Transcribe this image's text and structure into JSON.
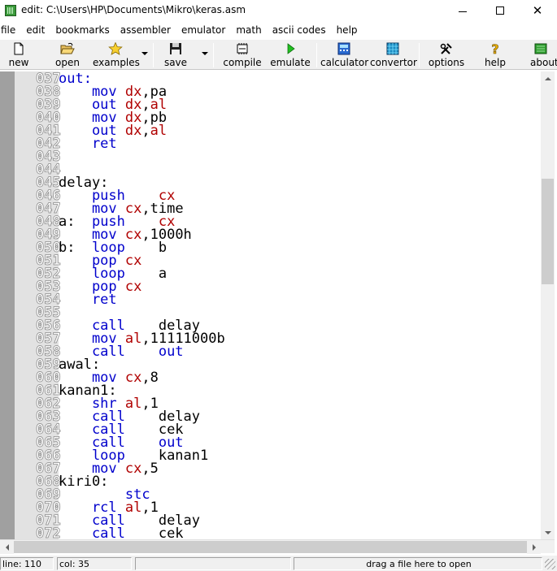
{
  "window": {
    "title": "edit: C:\\Users\\HP\\Documents\\Mikro\\keras.asm",
    "minimize": "minimize",
    "maximize": "maximize",
    "close": "✕"
  },
  "menu": [
    "file",
    "edit",
    "bookmarks",
    "assembler",
    "emulator",
    "math",
    "ascii codes",
    "help"
  ],
  "toolbar": {
    "new": "new",
    "open": "open",
    "examples": "examples",
    "save": "save",
    "compile": "compile",
    "emulate": "emulate",
    "calculator": "calculator",
    "convertor": "convertor",
    "options": "options",
    "help": "help",
    "about": "about"
  },
  "editor": {
    "lines": [
      {
        "num": "037",
        "segs": [
          {
            "t": "out:",
            "c": "kw"
          }
        ]
      },
      {
        "num": "038",
        "segs": [
          {
            "t": "    mov ",
            "c": "kw"
          },
          {
            "t": "dx",
            "c": "reg"
          },
          {
            "t": ",pa",
            "c": "plain"
          }
        ]
      },
      {
        "num": "039",
        "segs": [
          {
            "t": "    out ",
            "c": "kw"
          },
          {
            "t": "dx",
            "c": "reg"
          },
          {
            "t": ",",
            "c": "plain"
          },
          {
            "t": "al",
            "c": "reg"
          }
        ]
      },
      {
        "num": "040",
        "segs": [
          {
            "t": "    mov ",
            "c": "kw"
          },
          {
            "t": "dx",
            "c": "reg"
          },
          {
            "t": ",pb",
            "c": "plain"
          }
        ]
      },
      {
        "num": "041",
        "segs": [
          {
            "t": "    out ",
            "c": "kw"
          },
          {
            "t": "dx",
            "c": "reg"
          },
          {
            "t": ",",
            "c": "plain"
          },
          {
            "t": "al",
            "c": "reg"
          }
        ]
      },
      {
        "num": "042",
        "segs": [
          {
            "t": "    ret",
            "c": "kw"
          }
        ]
      },
      {
        "num": "043",
        "segs": []
      },
      {
        "num": "044",
        "segs": []
      },
      {
        "num": "045",
        "segs": [
          {
            "t": "delay:",
            "c": "plain"
          }
        ]
      },
      {
        "num": "046",
        "segs": [
          {
            "t": "    push    ",
            "c": "kw"
          },
          {
            "t": "cx",
            "c": "reg"
          }
        ]
      },
      {
        "num": "047",
        "segs": [
          {
            "t": "    mov ",
            "c": "kw"
          },
          {
            "t": "cx",
            "c": "reg"
          },
          {
            "t": ",time",
            "c": "plain"
          }
        ]
      },
      {
        "num": "048",
        "segs": [
          {
            "t": "a:  ",
            "c": "plain"
          },
          {
            "t": "push    ",
            "c": "kw"
          },
          {
            "t": "cx",
            "c": "reg"
          }
        ]
      },
      {
        "num": "049",
        "segs": [
          {
            "t": "    mov ",
            "c": "kw"
          },
          {
            "t": "cx",
            "c": "reg"
          },
          {
            "t": ",1000h",
            "c": "plain"
          }
        ]
      },
      {
        "num": "050",
        "segs": [
          {
            "t": "b:  ",
            "c": "plain"
          },
          {
            "t": "loop    ",
            "c": "kw"
          },
          {
            "t": "b",
            "c": "plain"
          }
        ]
      },
      {
        "num": "051",
        "segs": [
          {
            "t": "    pop ",
            "c": "kw"
          },
          {
            "t": "cx",
            "c": "reg"
          }
        ]
      },
      {
        "num": "052",
        "segs": [
          {
            "t": "    loop    ",
            "c": "kw"
          },
          {
            "t": "a",
            "c": "plain"
          }
        ]
      },
      {
        "num": "053",
        "segs": [
          {
            "t": "    pop ",
            "c": "kw"
          },
          {
            "t": "cx",
            "c": "reg"
          }
        ]
      },
      {
        "num": "054",
        "segs": [
          {
            "t": "    ret",
            "c": "kw"
          }
        ]
      },
      {
        "num": "055",
        "segs": []
      },
      {
        "num": "056",
        "segs": [
          {
            "t": "    call    ",
            "c": "kw"
          },
          {
            "t": "delay",
            "c": "plain"
          }
        ]
      },
      {
        "num": "057",
        "segs": [
          {
            "t": "    mov ",
            "c": "kw"
          },
          {
            "t": "al",
            "c": "reg"
          },
          {
            "t": ",11111000b",
            "c": "plain"
          }
        ]
      },
      {
        "num": "058",
        "segs": [
          {
            "t": "    call    ",
            "c": "kw"
          },
          {
            "t": "out",
            "c": "kw"
          }
        ]
      },
      {
        "num": "059",
        "segs": [
          {
            "t": "awal:",
            "c": "plain"
          }
        ]
      },
      {
        "num": "060",
        "segs": [
          {
            "t": "    mov ",
            "c": "kw"
          },
          {
            "t": "cx",
            "c": "reg"
          },
          {
            "t": ",8",
            "c": "plain"
          }
        ]
      },
      {
        "num": "061",
        "segs": [
          {
            "t": "kanan1:",
            "c": "plain"
          }
        ]
      },
      {
        "num": "062",
        "segs": [
          {
            "t": "    shr ",
            "c": "kw"
          },
          {
            "t": "al",
            "c": "reg"
          },
          {
            "t": ",1",
            "c": "plain"
          }
        ]
      },
      {
        "num": "063",
        "segs": [
          {
            "t": "    call    ",
            "c": "kw"
          },
          {
            "t": "delay",
            "c": "plain"
          }
        ]
      },
      {
        "num": "064",
        "segs": [
          {
            "t": "    call    ",
            "c": "kw"
          },
          {
            "t": "cek",
            "c": "plain"
          }
        ]
      },
      {
        "num": "065",
        "segs": [
          {
            "t": "    call    ",
            "c": "kw"
          },
          {
            "t": "out",
            "c": "kw"
          }
        ]
      },
      {
        "num": "066",
        "segs": [
          {
            "t": "    loop    ",
            "c": "kw"
          },
          {
            "t": "kanan1",
            "c": "plain"
          }
        ]
      },
      {
        "num": "067",
        "segs": [
          {
            "t": "    mov ",
            "c": "kw"
          },
          {
            "t": "cx",
            "c": "reg"
          },
          {
            "t": ",5",
            "c": "plain"
          }
        ]
      },
      {
        "num": "068",
        "segs": [
          {
            "t": "kiri0:",
            "c": "plain"
          }
        ]
      },
      {
        "num": "069",
        "segs": [
          {
            "t": "        stc",
            "c": "kw"
          }
        ]
      },
      {
        "num": "070",
        "segs": [
          {
            "t": "    rcl ",
            "c": "kw"
          },
          {
            "t": "al",
            "c": "reg"
          },
          {
            "t": ",1",
            "c": "plain"
          }
        ]
      },
      {
        "num": "071",
        "segs": [
          {
            "t": "    call    ",
            "c": "kw"
          },
          {
            "t": "delay",
            "c": "plain"
          }
        ]
      },
      {
        "num": "072",
        "segs": [
          {
            "t": "    call    ",
            "c": "kw"
          },
          {
            "t": "cek",
            "c": "plain"
          }
        ]
      }
    ]
  },
  "scroll": {
    "vertical_position": 0.28,
    "vertical_visible_fraction": 0.24,
    "horizontal_position": 0,
    "horizontal_visible_fraction": 1.0
  },
  "status": {
    "line": "line: 110",
    "col": "col: 35",
    "drop_hint": "drag a file here to open"
  },
  "colors": {
    "keyword": "#0000cc",
    "register": "#b00000",
    "plain": "#000000",
    "gutter": "#e2e2e2",
    "gutter_strip": "#a0a0a0"
  }
}
